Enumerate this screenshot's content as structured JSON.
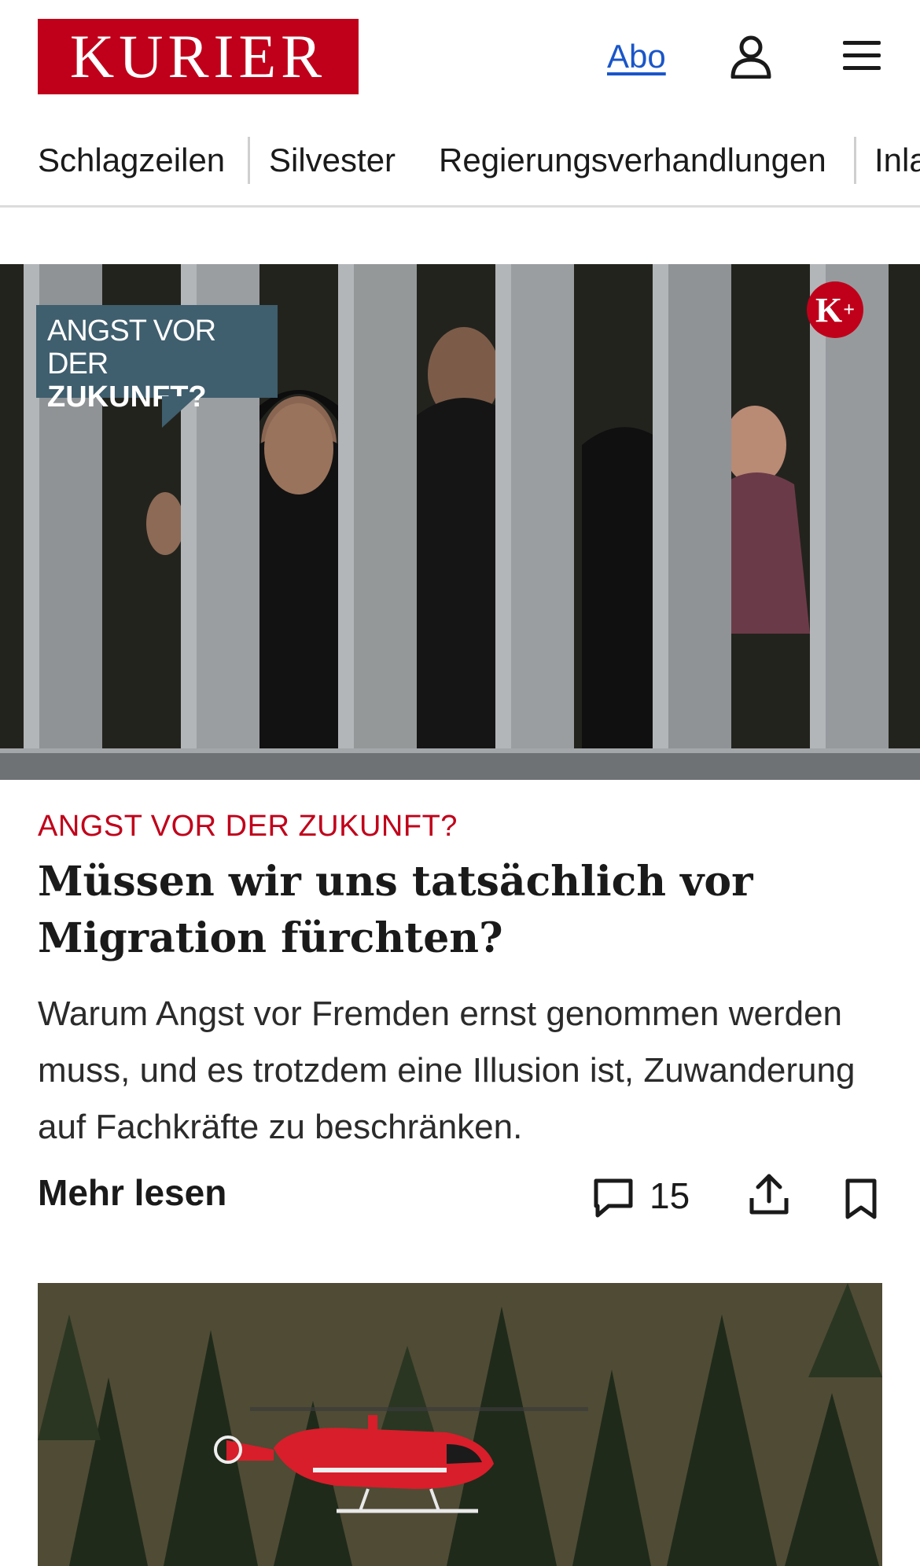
{
  "header": {
    "logo_text": "KURIER",
    "abo_label": "Abo",
    "user_icon": "user-icon",
    "menu_icon": "menu-icon",
    "brand_color": "#c0001a",
    "link_color": "#1a56c9"
  },
  "nav": {
    "items": [
      {
        "label": "Schlagzeilen"
      },
      {
        "label": "Silvester"
      },
      {
        "label": "Regierungsverhandlungen"
      },
      {
        "label": "Inla"
      }
    ]
  },
  "hero": {
    "badge_line1": "ANGST VOR DER",
    "badge_line2": "ZUKUNFT?",
    "kplus_label": "K",
    "kplus_sup": "+"
  },
  "article": {
    "kicker": "ANGST VOR DER ZUKUNFT?",
    "headline": "Müssen wir uns tatsächlich vor Migration fürchten?",
    "teaser": "Warum Angst vor Fremden ernst genommen werden muss, und es trotzdem eine Illusion ist, Zuwanderung auf Fachkräfte zu beschränken.",
    "more_label": "Mehr lesen",
    "comment_count": "15",
    "icons": [
      "comment-icon",
      "share-icon",
      "bookmark-icon"
    ]
  },
  "second_teaser": {
    "image_subject": "red-helicopter-over-forest"
  }
}
